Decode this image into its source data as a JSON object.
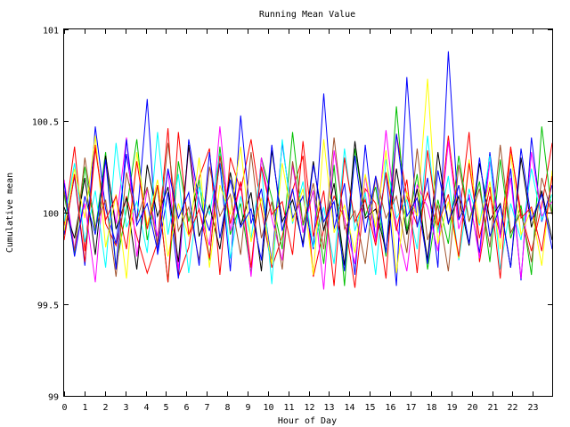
{
  "chart_data": {
    "type": "line",
    "title": "Running Mean Value",
    "xlabel": "Hour of Day",
    "ylabel": "Cumulative mean",
    "xlim": [
      0,
      23.95
    ],
    "ylim": [
      99,
      101
    ],
    "xticks": [
      0,
      1,
      2,
      3,
      4,
      5,
      6,
      7,
      8,
      9,
      10,
      11,
      12,
      13,
      14,
      15,
      16,
      17,
      18,
      19,
      20,
      21,
      22,
      23
    ],
    "xtick_labels": [
      "0",
      "1",
      "2",
      "3",
      "4",
      "5",
      "6",
      "7",
      "8",
      "9",
      "10",
      "11",
      "12",
      "13",
      "14",
      "15",
      "16",
      "17",
      "18",
      "19",
      "20",
      "21",
      "22",
      "23"
    ],
    "yticks": [
      99,
      99.5,
      100,
      100.5,
      101
    ],
    "ytick_labels": [
      "99",
      "99.5",
      "100",
      "100.5",
      "101"
    ],
    "grid": false,
    "legend": "none",
    "series_colors": [
      "#ff0000",
      "#00c000",
      "#0000ff",
      "#ff00ff",
      "#00ffff",
      "#000000",
      "#ffff00",
      "#a0522d",
      "#ff0000",
      "#0000ff",
      "#00c000",
      "#ff00ff",
      "#0000ff",
      "#00ffff",
      "#ff0000",
      "#0000ff"
    ],
    "series": [
      {
        "values": [
          99.93,
          100.36,
          99.79,
          100.37,
          99.94,
          99.82,
          100.09,
          99.87,
          99.67,
          99.84,
          100.46,
          99.65,
          99.81,
          100.19,
          100.35,
          99.66,
          100.3,
          100.12,
          100.4,
          100.02,
          99.7,
          99.87,
          100.12,
          100.31,
          99.65,
          99.91,
          100.09,
          99.97,
          99.59,
          100.13,
          100.05,
          99.64,
          100.43,
          100.09,
          99.93,
          100.11,
          99.9,
          100.42,
          99.96,
          100.44,
          99.73,
          100.09,
          99.88,
          100.35,
          100.0,
          99.79,
          100.04,
          100.38
        ]
      },
      {
        "values": [
          100.1,
          99.78,
          100.25,
          99.9,
          100.33,
          99.7,
          100.02,
          100.4,
          99.85,
          100.15,
          99.62,
          100.28,
          99.95,
          100.18,
          99.74,
          100.36,
          99.88,
          100.05,
          99.67,
          100.3,
          100.08,
          99.8,
          100.44,
          99.93,
          100.12,
          99.72,
          100.26,
          99.6,
          100.35,
          99.98,
          100.14,
          99.76,
          100.58,
          99.9,
          100.21,
          99.69,
          100.07,
          99.83,
          100.31,
          99.95,
          100.17,
          99.73,
          100.29,
          99.86,
          100.04,
          99.66,
          100.47,
          99.99
        ]
      },
      {
        "values": [
          99.88,
          100.2,
          99.71,
          100.47,
          100.02,
          99.83,
          100.32,
          99.95,
          100.62,
          99.77,
          100.11,
          99.64,
          100.4,
          100.06,
          99.9,
          100.27,
          99.68,
          100.53,
          99.94,
          100.13,
          99.73,
          100.38,
          99.97,
          100.09,
          99.8,
          100.65,
          99.91,
          100.16,
          99.66,
          100.37,
          99.85,
          100.22,
          99.6,
          100.74,
          99.92,
          100.19,
          99.7,
          100.88,
          99.96,
          100.08,
          99.78,
          100.33,
          99.87,
          100.24,
          99.63,
          100.41,
          99.95,
          100.15
        ]
      },
      {
        "values": [
          100.18,
          99.8,
          100.05,
          99.62,
          100.29,
          99.94,
          100.41,
          99.76,
          100.13,
          99.87,
          100.23,
          99.69,
          100.36,
          100.01,
          99.82,
          100.47,
          99.9,
          100.16,
          99.65,
          100.3,
          99.97,
          99.74,
          100.26,
          99.89,
          100.12,
          99.58,
          100.34,
          99.96,
          99.72,
          100.2,
          99.84,
          100.45,
          99.93,
          99.68,
          100.15,
          100.03,
          99.79,
          100.39,
          99.91,
          100.1,
          99.75,
          100.28,
          99.86,
          100.19,
          99.64,
          100.33,
          99.98,
          100.06
        ]
      },
      {
        "values": [
          99.95,
          100.27,
          99.84,
          100.12,
          99.7,
          100.38,
          99.92,
          100.06,
          99.78,
          100.44,
          99.88,
          100.21,
          99.67,
          100.14,
          99.99,
          100.32,
          99.75,
          100.09,
          99.86,
          100.25,
          99.61,
          100.4,
          99.94,
          100.17,
          99.81,
          100.03,
          99.72,
          100.35,
          99.9,
          100.11,
          99.66,
          100.29,
          99.97,
          100.07,
          99.8,
          100.42,
          99.89,
          100.2,
          99.74,
          100.13,
          99.93,
          100.31,
          99.69,
          100.05,
          99.85,
          100.24,
          99.96,
          100.1
        ]
      },
      {
        "values": [
          100.03,
          99.86,
          100.19,
          99.77,
          100.31,
          99.91,
          100.08,
          99.69,
          100.26,
          99.98,
          100.14,
          99.73,
          100.37,
          99.87,
          100.04,
          99.8,
          100.22,
          99.93,
          100.11,
          99.68,
          100.34,
          99.95,
          100.07,
          99.83,
          100.28,
          99.9,
          100.16,
          99.71,
          100.39,
          99.97,
          100.02,
          99.79,
          100.24,
          99.88,
          100.13,
          99.74,
          100.33,
          99.94,
          100.09,
          99.82,
          100.27,
          99.96,
          100.05,
          99.7,
          100.3,
          99.92,
          100.12,
          99.85
        ]
      },
      {
        "values": [
          99.9,
          100.24,
          99.97,
          100.42,
          99.81,
          100.1,
          99.64,
          100.33,
          99.93,
          100.18,
          99.76,
          100.05,
          99.87,
          100.3,
          99.7,
          100.15,
          99.99,
          100.36,
          99.84,
          100.08,
          99.72,
          100.27,
          99.95,
          100.13,
          99.66,
          100.4,
          99.89,
          100.04,
          99.78,
          100.21,
          99.92,
          100.34,
          99.67,
          100.11,
          99.98,
          100.73,
          99.83,
          100.06,
          99.75,
          100.29,
          99.94,
          100.17,
          99.8,
          100.32,
          99.88,
          100.02,
          99.71,
          100.23
        ]
      },
      {
        "values": [
          100.12,
          99.79,
          100.3,
          99.92,
          100.07,
          99.65,
          100.22,
          99.96,
          100.14,
          99.82,
          100.38,
          99.9,
          100.03,
          99.74,
          100.25,
          99.98,
          100.1,
          99.77,
          100.33,
          99.86,
          100.06,
          99.69,
          100.28,
          99.94,
          100.16,
          99.8,
          100.41,
          99.91,
          100.01,
          99.72,
          100.2,
          99.97,
          100.09,
          99.78,
          100.35,
          99.85,
          100.04,
          99.68,
          100.26,
          99.95,
          100.13,
          99.81,
          100.37,
          99.89,
          100.0,
          99.73,
          100.19,
          99.99
        ]
      },
      {
        "values": [
          99.85,
          100.21,
          99.73,
          100.35,
          99.96,
          100.09,
          99.8,
          100.28,
          99.91,
          100.15,
          99.62,
          100.44,
          99.88,
          100.02,
          99.75,
          100.31,
          99.94,
          100.17,
          99.7,
          100.25,
          99.99,
          100.06,
          99.77,
          100.39,
          99.87,
          100.12,
          99.6,
          100.3,
          99.95,
          100.07,
          99.82,
          100.22,
          99.9,
          100.18,
          99.67,
          100.34,
          99.93,
          100.1,
          99.76,
          100.27,
          99.86,
          100.14,
          99.64,
          100.36,
          99.97,
          100.03,
          99.79,
          100.2
        ]
      },
      {
        "values": [
          100.16,
          99.76,
          100.09,
          99.88,
          100.29,
          99.69,
          100.4,
          99.93,
          100.05,
          99.79,
          100.24,
          99.97,
          100.11,
          99.71,
          100.33,
          99.86,
          100.18,
          99.92,
          100.02,
          99.74,
          100.37,
          99.9,
          100.13,
          99.81,
          100.26,
          99.95,
          100.06,
          99.68,
          100.31,
          99.89,
          100.2,
          99.78,
          100.43,
          99.98,
          100.08,
          99.72,
          100.23,
          99.94,
          100.15,
          99.83,
          100.3,
          99.87,
          100.04,
          99.7,
          100.35,
          99.96,
          100.1,
          99.8
        ]
      }
    ]
  }
}
